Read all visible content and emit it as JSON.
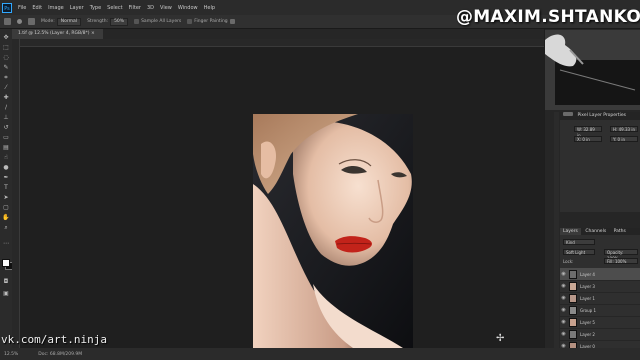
{
  "watermarks": {
    "top": "@MAXIM.SHTANKO",
    "bottom": "vk.com/art.ninja"
  },
  "menubar": {
    "logo": "Ps",
    "items": [
      "File",
      "Edit",
      "Image",
      "Layer",
      "Type",
      "Select",
      "Filter",
      "3D",
      "View",
      "Window",
      "Help"
    ]
  },
  "options": {
    "mode_label": "Mode:",
    "mode_value": "Normal",
    "strength_label": "Strength:",
    "strength_value": "50%",
    "sample_all": "Sample All Layers",
    "finger_painting": "Finger Painting"
  },
  "document": {
    "tab_title": "1.tif @ 12.5% (Layer 4, RGB/8*) ×"
  },
  "status": {
    "zoom": "12.5%",
    "doc": "Doc: 68.8M/209.9M"
  },
  "properties": {
    "title": "Pixel Layer Properties",
    "w": "W: 32.89 in",
    "h": "H: 49.33 in",
    "x": "X: 0 in",
    "y": "Y: 0 in"
  },
  "layers_panel": {
    "tabs": [
      "Layers",
      "Channels",
      "Paths"
    ],
    "kind": "Kind",
    "blend_mode": "Soft Light",
    "opacity": "Opacity: 100%",
    "lock": "Lock:",
    "fill": "Fill: 100%",
    "layers": [
      {
        "name": "Layer 4",
        "selected": true
      },
      {
        "name": "Layer 3",
        "selected": false
      },
      {
        "name": "Layer 1",
        "selected": false
      },
      {
        "name": "Group 1",
        "selected": false
      },
      {
        "name": "Layer 5",
        "selected": false
      },
      {
        "name": "Layer 2",
        "selected": false
      },
      {
        "name": "Layer 0",
        "selected": false
      }
    ]
  },
  "colors": {
    "accent": "#31a8ff",
    "lips": "#c2231a",
    "skin": "#e9c7b0",
    "hair": "#c79a78"
  }
}
